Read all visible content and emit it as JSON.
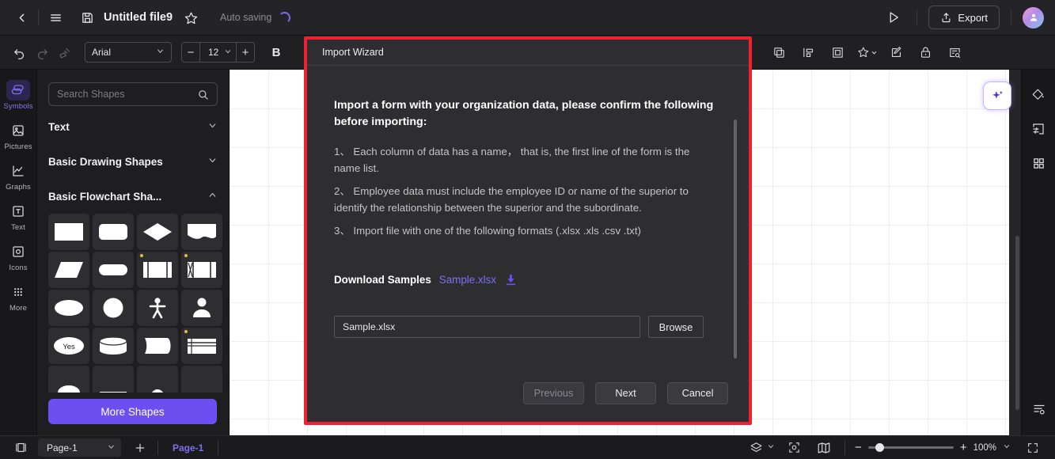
{
  "titlebar": {
    "back_icon": "back-arrow-icon",
    "menu_icon": "hamburger-menu-icon",
    "save_icon": "save-disk-icon",
    "file_name": "Untitled file9",
    "favorite_icon": "star-icon",
    "autosave_label": "Auto saving",
    "spinner_icon": "loading-spinner-icon",
    "present_icon": "play-present-icon",
    "export_label": "Export",
    "export_icon": "upload-share-icon",
    "avatar_icon": "user-avatar"
  },
  "toolbar": {
    "undo_icon": "undo-icon",
    "redo_icon": "redo-icon",
    "format_painter_icon": "format-painter-icon",
    "font_family": "Arial",
    "font_size": "12",
    "decrease_label": "−",
    "increase_label": "+",
    "bold_label": "B",
    "right_icons": [
      "duplicate-icon",
      "align-icon",
      "group-icon",
      "effects-icon",
      "edit-pen-icon",
      "lock-icon",
      "find-replace-icon"
    ]
  },
  "left_rail": {
    "items": [
      {
        "label": "Symbols",
        "icon": "symbols-icon",
        "active": true
      },
      {
        "label": "Pictures",
        "icon": "pictures-icon",
        "active": false
      },
      {
        "label": "Graphs",
        "icon": "graphs-icon",
        "active": false
      },
      {
        "label": "Text",
        "icon": "text-icon",
        "active": false
      },
      {
        "label": "Icons",
        "icon": "icons-icon",
        "active": false
      },
      {
        "label": "More",
        "icon": "more-grid-icon",
        "active": false
      }
    ]
  },
  "shapes_panel": {
    "search_placeholder": "Search Shapes",
    "search_value": "",
    "search_icon": "search-icon",
    "sections": [
      {
        "title": "Text",
        "expanded": false
      },
      {
        "title": "Basic Drawing Shapes",
        "expanded": false
      },
      {
        "title": "Basic Flowchart Sha...",
        "expanded": true
      }
    ],
    "shape_cells": [
      "rectangle-shape",
      "rounded-rectangle-shape",
      "diamond-shape",
      "document-shape",
      "parallelogram-shape",
      "stadium-shape",
      "predefined-process-shape",
      "internal-storage-shape",
      "ellipse-shape",
      "circle-shape",
      "actor-shape",
      "person-shape",
      "decision-yes-shape",
      "cylinder-shape",
      "delay-shape",
      "table-shape",
      "partial-shape-a",
      "partial-shape-b",
      "partial-shape-c",
      "partial-shape-d"
    ],
    "yes_label": "Yes",
    "more_shapes_label": "More Shapes"
  },
  "canvas": {
    "ai_button_icon": "ai-sparkle-icon",
    "scrollbar": "vertical-scrollbar"
  },
  "right_rail": {
    "items": [
      {
        "icon": "fill-paint-icon"
      },
      {
        "icon": "page-settings-icon"
      },
      {
        "icon": "app-grid-icon"
      }
    ],
    "bottom_icon": "list-settings-icon"
  },
  "statusbar": {
    "panel_toggle_icon": "panel-toggle-icon",
    "page_select": "Page-1",
    "add_page_icon": "+",
    "page_tab": "Page-1",
    "layers_icon": "layers-icon",
    "focus_icon": "focus-target-icon",
    "map_icon": "map-overview-icon",
    "zoom_out_label": "−",
    "zoom_in_label": "+",
    "zoom_level": "100%",
    "fullscreen_icon": "fullscreen-icon"
  },
  "modal": {
    "title": "Import Wizard",
    "heading": "Import a form with your organization data, please confirm the following before importing:",
    "items": [
      "1、 Each column of data has a name， that is, the first line of the form is the name list.",
      "2、 Employee data must include the employee ID or name of the superior to identify the relationship between the superior and the subordinate.",
      "3、 Import file with one of the following formats (.xlsx .xls .csv .txt)"
    ],
    "download_label": "Download Samples",
    "sample_link": "Sample.xlsx",
    "download_icon": "download-icon",
    "file_value": "Sample.xlsx",
    "browse_label": "Browse",
    "previous_label": "Previous",
    "next_label": "Next",
    "cancel_label": "Cancel",
    "highlight_color": "#f02030",
    "accent_color": "#6c4ff0"
  }
}
